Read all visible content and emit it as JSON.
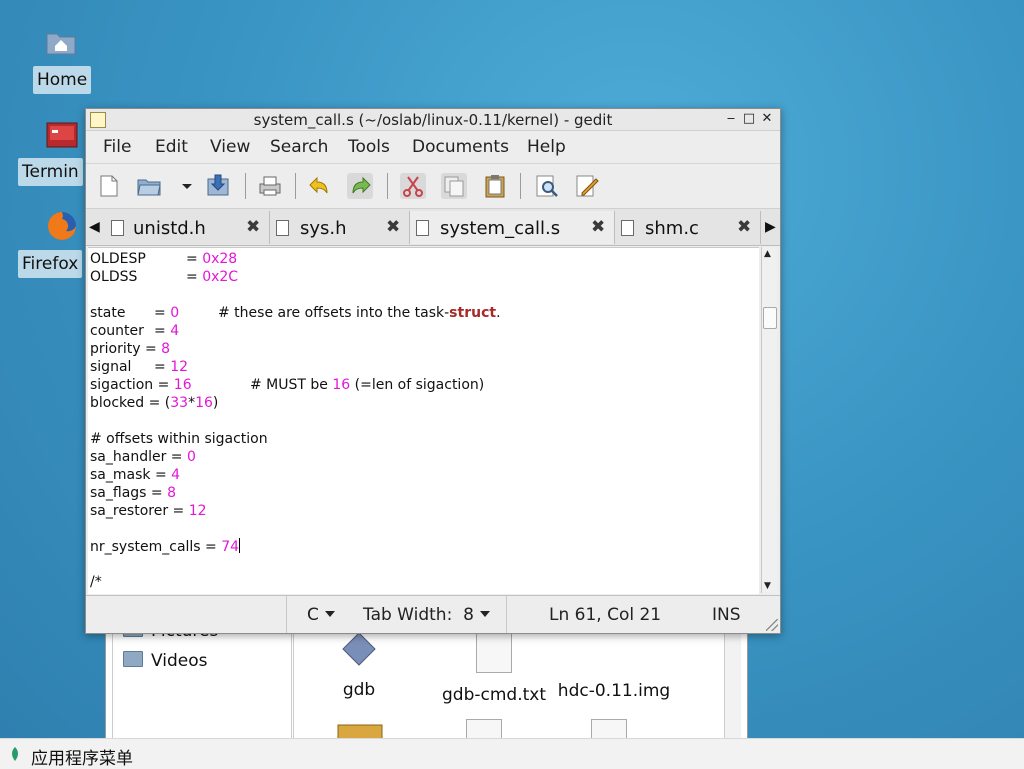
{
  "desktop": {
    "icons": [
      {
        "label": "Home"
      },
      {
        "label": "Termin"
      },
      {
        "label": "Firefox"
      }
    ]
  },
  "file_manager": {
    "sidebar": [
      {
        "label": "Pictures"
      },
      {
        "label": "Videos"
      }
    ],
    "files": [
      {
        "name": "gdb"
      },
      {
        "name": "gdb-cmd.txt"
      },
      {
        "name": "hdc-0.11.img"
      }
    ]
  },
  "gedit": {
    "title": "system_call.s (~/oslab/linux-0.11/kernel) - gedit",
    "menu": {
      "file": "File",
      "edit": "Edit",
      "view": "View",
      "search": "Search",
      "tools": "Tools",
      "documents": "Documents",
      "help": "Help"
    },
    "tabs": [
      {
        "label": "unistd.h"
      },
      {
        "label": "sys.h"
      },
      {
        "label": "system_call.s"
      },
      {
        "label": "shm.c"
      }
    ],
    "code": {
      "oldesp": {
        "name": "OLDESP",
        "eq": "= ",
        "val": "0x28"
      },
      "oldss": {
        "name": "OLDSS",
        "eq": "= ",
        "val": "0x2C"
      },
      "state": {
        "name": "state",
        "eq": "= ",
        "val": "0",
        "comment_pre": "# these are offsets into the task-",
        "comment_kw": "struct",
        "comment_post": "."
      },
      "counter": {
        "name": "counter",
        "eq": "= ",
        "val": "4"
      },
      "priority": {
        "name": "priority = ",
        "val": "8"
      },
      "signal": {
        "name": "signal",
        "eq": "= ",
        "val": "12"
      },
      "sigaction": {
        "name": "sigaction = ",
        "val": "16",
        "comment_pre": "# MUST be ",
        "comment_num": "16",
        "comment_post": " (=len of sigaction)"
      },
      "blocked": {
        "name": "blocked = (",
        "a": "33",
        "mul": "*",
        "b": "16",
        "close": ")"
      },
      "offsets_comment": "# offsets within sigaction",
      "sa_handler": {
        "name": "sa_handler = ",
        "val": "0"
      },
      "sa_mask": {
        "name": "sa_mask = ",
        "val": "4"
      },
      "sa_flags": {
        "name": "sa_flags = ",
        "val": "8"
      },
      "sa_restorer": {
        "name": "sa_restorer = ",
        "val": "12"
      },
      "nr_system_calls": {
        "name": "nr_system_calls = ",
        "val": "74"
      },
      "block_comment": "/*"
    },
    "status": {
      "language": "C",
      "tab_width_label": "Tab Width:",
      "tab_width_value": "8",
      "cursor": "Ln 61, Col 21",
      "mode": "INS"
    }
  },
  "panel": {
    "app_menu": "应用程序菜单"
  }
}
